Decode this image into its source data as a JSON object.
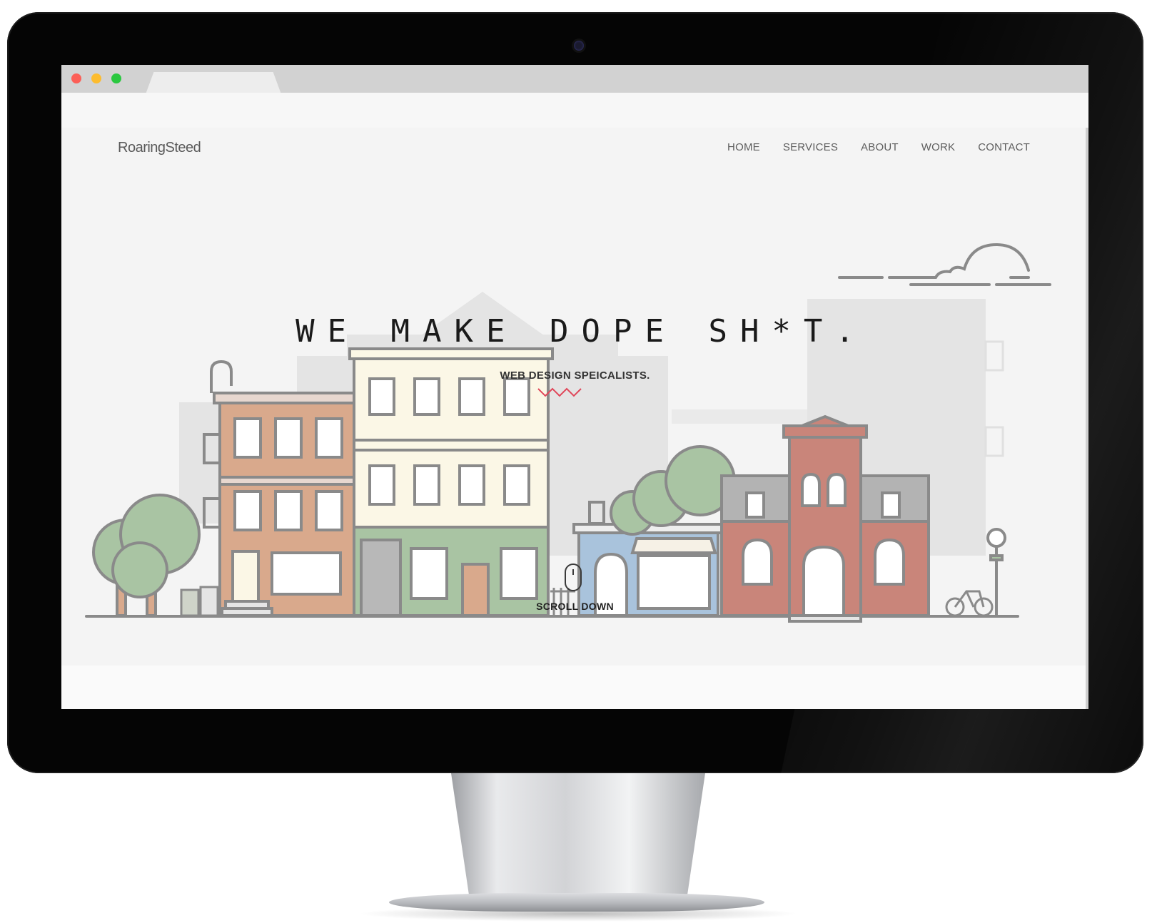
{
  "site": {
    "logo": "RoaringSteed",
    "nav": {
      "home": "HOME",
      "services": "SERVICES",
      "about": "ABOUT",
      "work": "WORK",
      "contact": "CONTACT"
    }
  },
  "hero": {
    "title": "WE MAKE DOPE SH*T.",
    "subtitle": "WEB DESIGN SPEICALISTS.",
    "accent_color": "#e0475a"
  },
  "scroll": {
    "label": "SCROLL DOWN",
    "icon": "mouse-icon"
  },
  "browser": {
    "window_buttons": [
      "close",
      "minimize",
      "maximize"
    ],
    "colors": {
      "close": "#fc5f57",
      "minimize": "#fdbc2e",
      "maximize": "#2ac840"
    }
  },
  "illustration": {
    "subject": "city street with buildings, trees and bicycle",
    "palette": {
      "outline": "#8a8a8a",
      "brick_orange": "#d9a98c",
      "cream": "#fbf7e6",
      "green": "#a9c4a3",
      "blue": "#a9c3dc",
      "red_brick": "#c9857a",
      "grey_roof": "#b3b3b3",
      "background_buildings": "#e6e6e6"
    }
  }
}
